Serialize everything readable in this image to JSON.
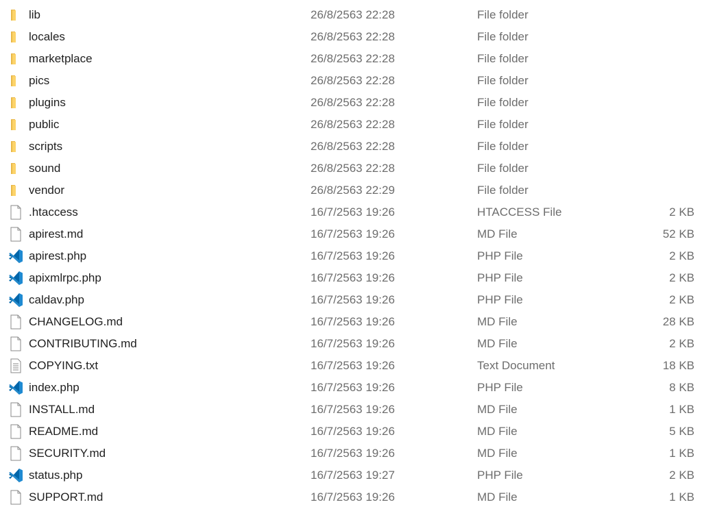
{
  "files": [
    {
      "name": "lib",
      "date": "26/8/2563 22:28",
      "type": "File folder",
      "size": "",
      "icon": "folder"
    },
    {
      "name": "locales",
      "date": "26/8/2563 22:28",
      "type": "File folder",
      "size": "",
      "icon": "folder"
    },
    {
      "name": "marketplace",
      "date": "26/8/2563 22:28",
      "type": "File folder",
      "size": "",
      "icon": "folder"
    },
    {
      "name": "pics",
      "date": "26/8/2563 22:28",
      "type": "File folder",
      "size": "",
      "icon": "folder"
    },
    {
      "name": "plugins",
      "date": "26/8/2563 22:28",
      "type": "File folder",
      "size": "",
      "icon": "folder"
    },
    {
      "name": "public",
      "date": "26/8/2563 22:28",
      "type": "File folder",
      "size": "",
      "icon": "folder"
    },
    {
      "name": "scripts",
      "date": "26/8/2563 22:28",
      "type": "File folder",
      "size": "",
      "icon": "folder"
    },
    {
      "name": "sound",
      "date": "26/8/2563 22:28",
      "type": "File folder",
      "size": "",
      "icon": "folder"
    },
    {
      "name": "vendor",
      "date": "26/8/2563 22:29",
      "type": "File folder",
      "size": "",
      "icon": "folder"
    },
    {
      "name": ".htaccess",
      "date": "16/7/2563 19:26",
      "type": "HTACCESS File",
      "size": "2 KB",
      "icon": "file"
    },
    {
      "name": "apirest.md",
      "date": "16/7/2563 19:26",
      "type": "MD File",
      "size": "52 KB",
      "icon": "file"
    },
    {
      "name": "apirest.php",
      "date": "16/7/2563 19:26",
      "type": "PHP File",
      "size": "2 KB",
      "icon": "vscode"
    },
    {
      "name": "apixmlrpc.php",
      "date": "16/7/2563 19:26",
      "type": "PHP File",
      "size": "2 KB",
      "icon": "vscode"
    },
    {
      "name": "caldav.php",
      "date": "16/7/2563 19:26",
      "type": "PHP File",
      "size": "2 KB",
      "icon": "vscode"
    },
    {
      "name": "CHANGELOG.md",
      "date": "16/7/2563 19:26",
      "type": "MD File",
      "size": "28 KB",
      "icon": "file"
    },
    {
      "name": "CONTRIBUTING.md",
      "date": "16/7/2563 19:26",
      "type": "MD File",
      "size": "2 KB",
      "icon": "file"
    },
    {
      "name": "COPYING.txt",
      "date": "16/7/2563 19:26",
      "type": "Text Document",
      "size": "18 KB",
      "icon": "text"
    },
    {
      "name": "index.php",
      "date": "16/7/2563 19:26",
      "type": "PHP File",
      "size": "8 KB",
      "icon": "vscode"
    },
    {
      "name": "INSTALL.md",
      "date": "16/7/2563 19:26",
      "type": "MD File",
      "size": "1 KB",
      "icon": "file"
    },
    {
      "name": "README.md",
      "date": "16/7/2563 19:26",
      "type": "MD File",
      "size": "5 KB",
      "icon": "file"
    },
    {
      "name": "SECURITY.md",
      "date": "16/7/2563 19:26",
      "type": "MD File",
      "size": "1 KB",
      "icon": "file"
    },
    {
      "name": "status.php",
      "date": "16/7/2563 19:27",
      "type": "PHP File",
      "size": "2 KB",
      "icon": "vscode"
    },
    {
      "name": "SUPPORT.md",
      "date": "16/7/2563 19:26",
      "type": "MD File",
      "size": "1 KB",
      "icon": "file"
    }
  ]
}
